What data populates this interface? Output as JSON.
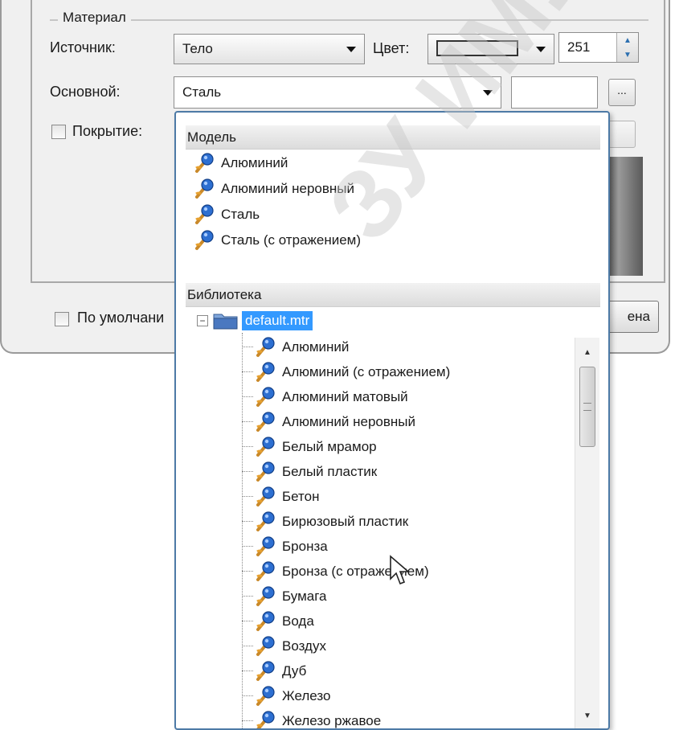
{
  "material_group": {
    "title": "Материал",
    "source_label": "Источник:",
    "source_value": "Тело",
    "color_label": "Цвет:",
    "color_value": "251",
    "base_label": "Основной:",
    "base_value": "Сталь",
    "browse_label": "...",
    "coating_label": "Покрытие:",
    "coating_checked": false
  },
  "bottom": {
    "default_label": "По умолчани",
    "button_label": "ена"
  },
  "dropdown": {
    "model_header": "Модель",
    "model_items": [
      "Алюминий",
      "Алюминий неровный",
      "Сталь",
      "Сталь (с отражением)"
    ],
    "library_header": "Библиотека",
    "library_root": "default.mtr",
    "library_expander": "−",
    "library_items": [
      "Алюминий",
      "Алюминий (с отражением)",
      "Алюминий матовый",
      "Алюминий неровный",
      "Белый мрамор",
      "Белый пластик",
      "Бетон",
      "Бирюзовый пластик",
      "Бронза",
      "Бронза (с отражением)",
      "Бумага",
      "Вода",
      "Воздух",
      "Дуб",
      "Железо",
      "Железо ржавое"
    ]
  },
  "watermark": "ЗУ ИМ.Н.Э",
  "colors": {
    "selection": "#3399ff",
    "popup_border": "#4d7aa6",
    "dialog_bg": "#f0f0f0"
  }
}
